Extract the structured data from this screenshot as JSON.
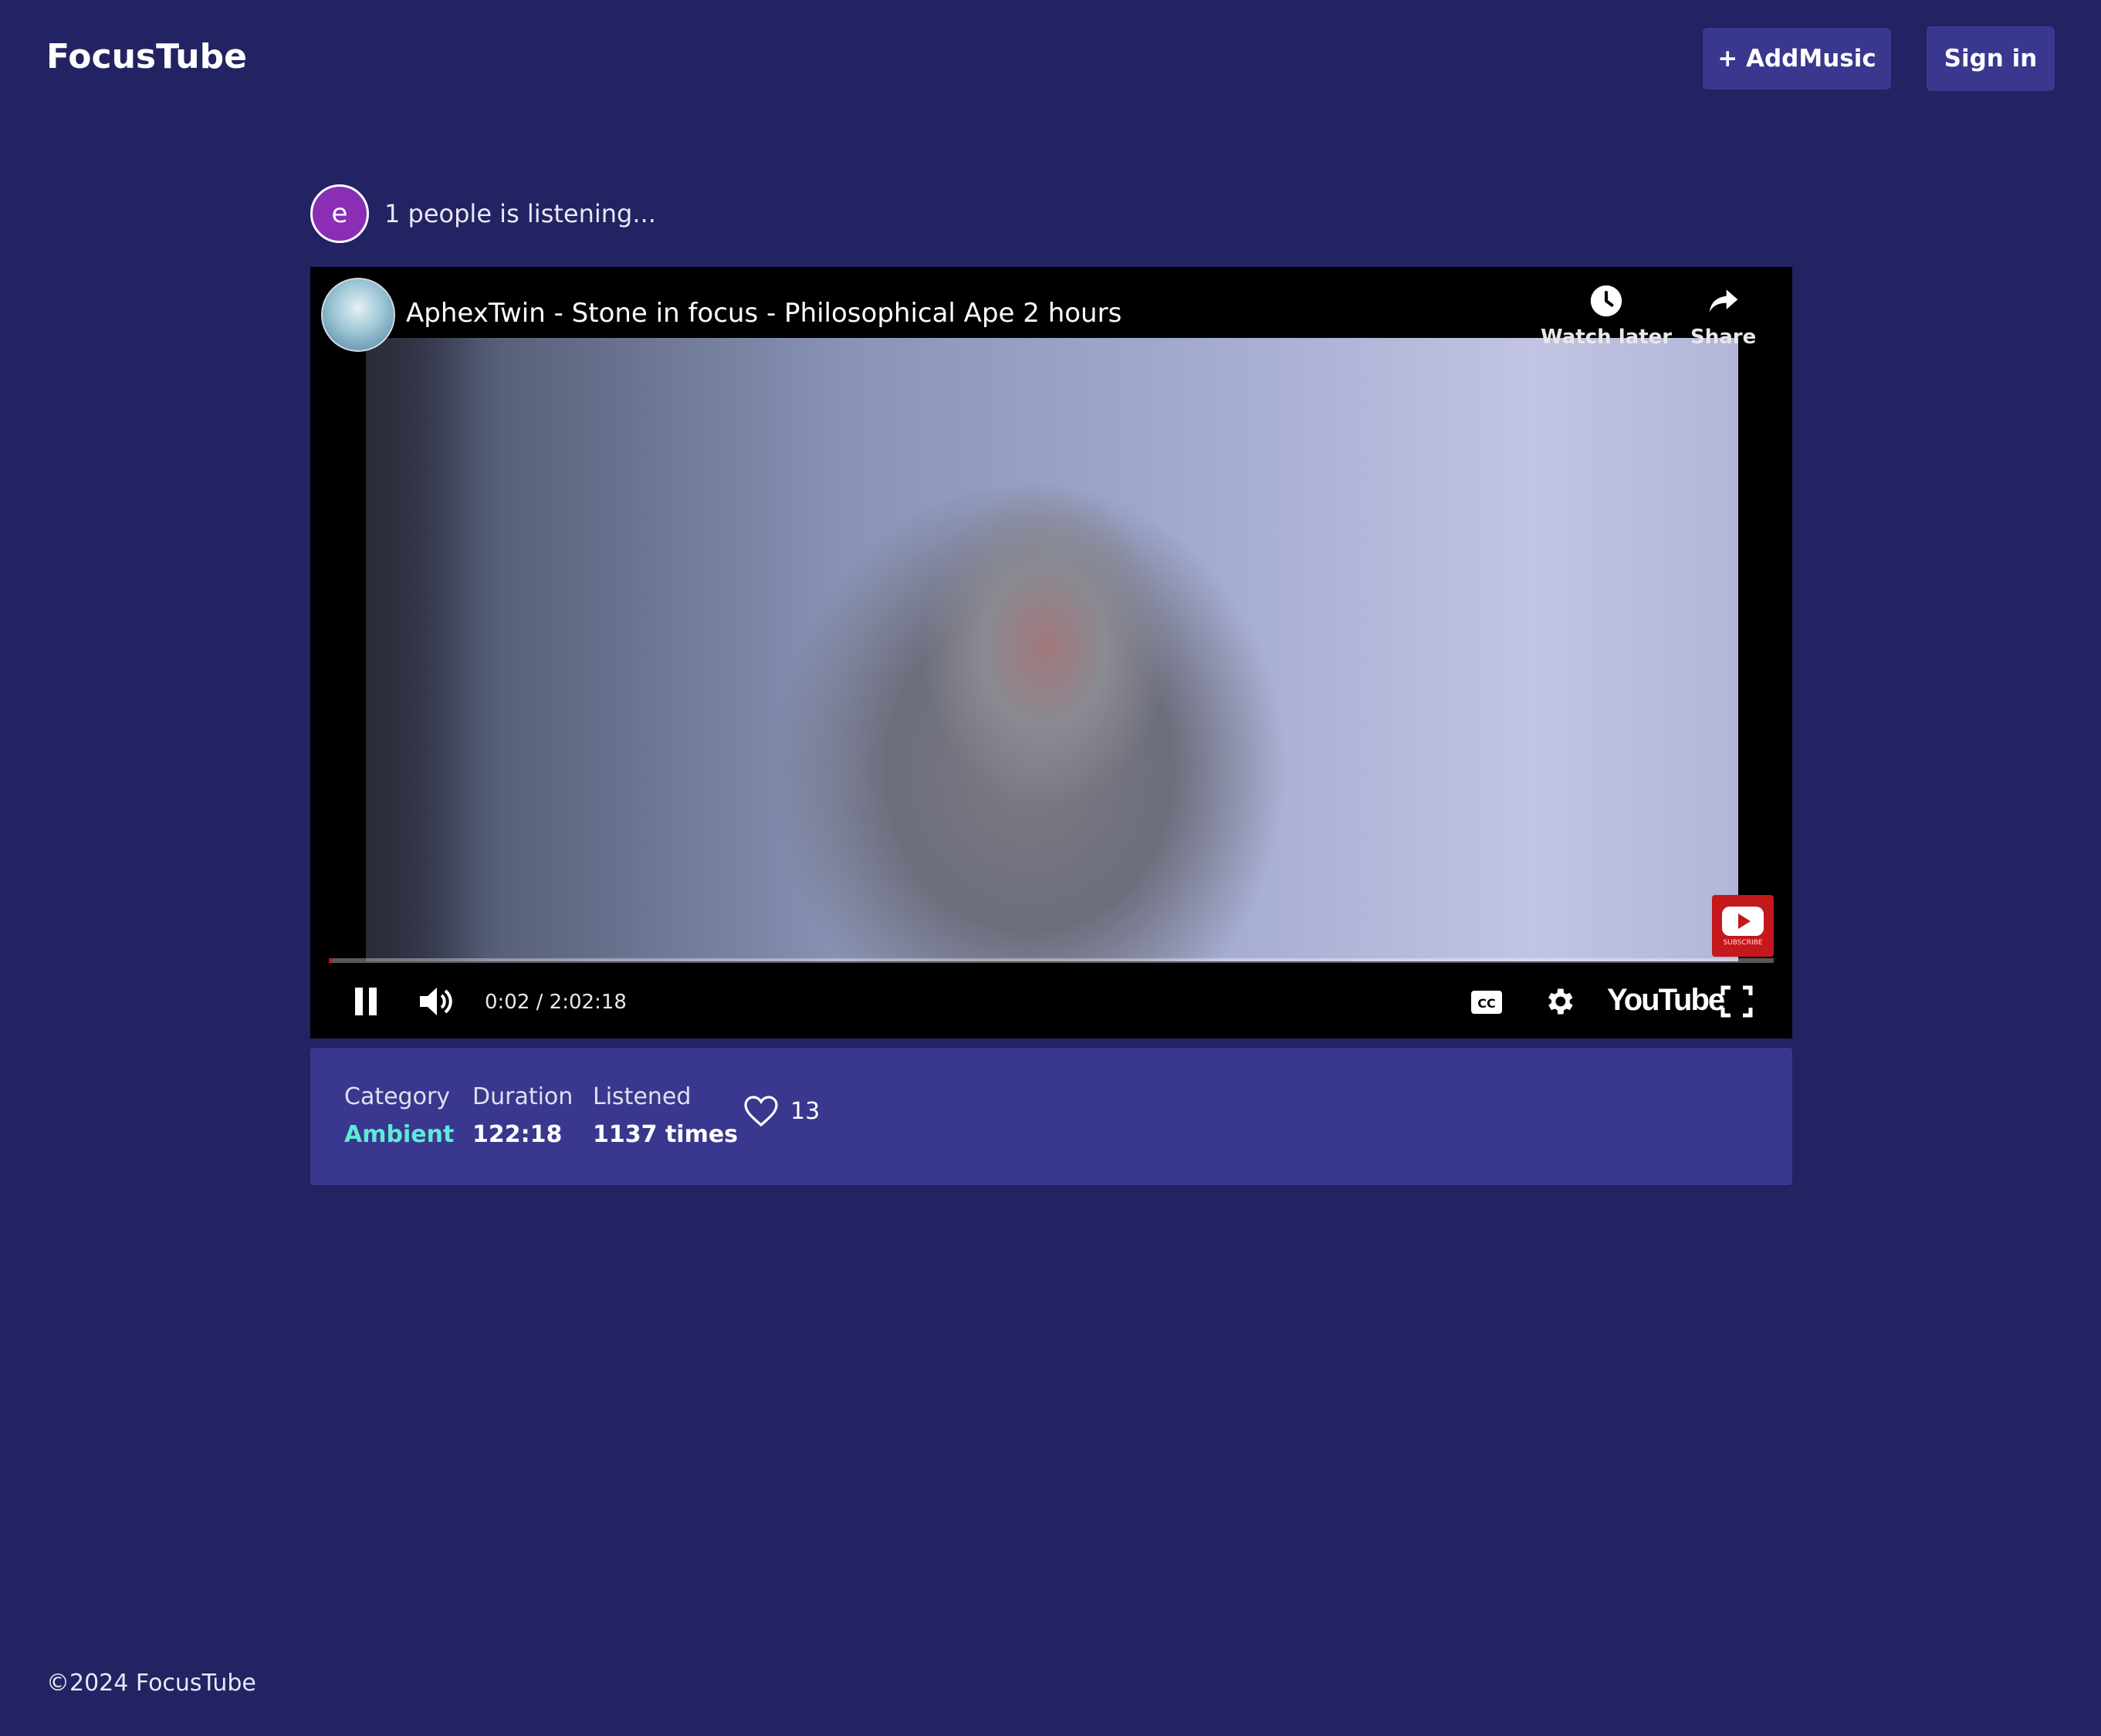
{
  "app": {
    "brand": "FocusTube"
  },
  "header": {
    "add_music_label": "+ AddMusic",
    "sign_in_label": "Sign in"
  },
  "listeners": {
    "avatar_initial": "e",
    "text": "1 people is listening..."
  },
  "player": {
    "video_title": "AphexTwin - Stone in focus - Philosophical Ape 2 hours",
    "watch_later_label": "Watch later",
    "share_label": "Share",
    "subscribe_label": "SUBSCRIBE",
    "time_display": "0:02 / 2:02:18",
    "brand_logo": "YouTube",
    "progress_fraction": 0.0003,
    "icons": [
      "pause-icon",
      "volume-icon",
      "captions-icon",
      "settings-icon",
      "fullscreen-icon",
      "clock-icon",
      "share-arrow-icon"
    ]
  },
  "info": {
    "category_label": "Category",
    "category_value": "Ambient",
    "duration_label": "Duration",
    "duration_value": "122:18",
    "listened_label": "Listened",
    "listened_value": "1137 times",
    "likes": "13"
  },
  "footer": {
    "copyright": "©2024 FocusTube"
  },
  "colors": {
    "background": "#232262",
    "panel": "#3a378f",
    "accent": "#5eead4",
    "avatar": "#8a2eb6"
  }
}
